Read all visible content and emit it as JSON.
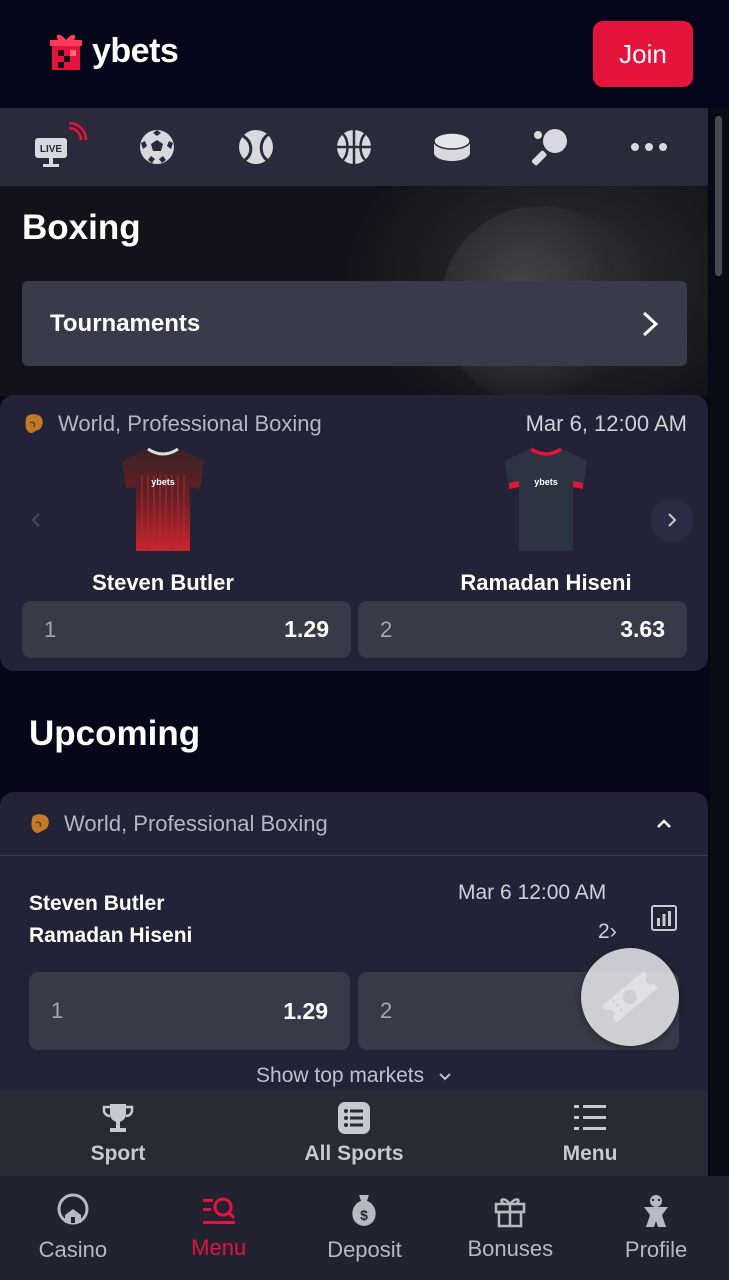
{
  "header": {
    "logo_text": "ybets",
    "join_label": "Join"
  },
  "sports_bar": {
    "items": [
      {
        "icon": "live-tv-icon",
        "badge": "LIVE"
      },
      {
        "icon": "soccer-ball-icon"
      },
      {
        "icon": "tennis-ball-icon"
      },
      {
        "icon": "basketball-icon"
      },
      {
        "icon": "ice-hockey-puck-icon"
      },
      {
        "icon": "table-tennis-icon"
      },
      {
        "icon": "more-icon"
      }
    ]
  },
  "hero": {
    "title": "Boxing",
    "tournaments_label": "Tournaments"
  },
  "featured_match": {
    "league": "World, Professional Boxing",
    "date": "Mar 6, 12:00 AM",
    "jersey_brand": "ybets",
    "team1": {
      "name": "Steven Butler",
      "jersey_color": "#b3232b"
    },
    "team2": {
      "name": "Ramadan Hiseni",
      "jersey_color": "#2c3442"
    },
    "odds": [
      {
        "label": "1",
        "value": "1.29"
      },
      {
        "label": "2",
        "value": "3.63"
      }
    ]
  },
  "upcoming": {
    "title": "Upcoming",
    "league": "World, Professional Boxing",
    "match": {
      "team1": "Steven Butler",
      "team2": "Ramadan Hiseni",
      "date": "Mar 6 12:00 AM",
      "more_markets": "2",
      "odds": [
        {
          "label": "1",
          "value": "1.29"
        },
        {
          "label": "2",
          "value": ""
        }
      ]
    },
    "show_top_markets": "Show top markets"
  },
  "sport_nav": {
    "items": [
      {
        "label": "Sport",
        "icon": "trophy-icon"
      },
      {
        "label": "All Sports",
        "icon": "list-icon"
      },
      {
        "label": "Menu",
        "icon": "menu-icon"
      }
    ]
  },
  "bottom_nav": {
    "items": [
      {
        "label": "Casino",
        "icon": "casino-icon",
        "active": false
      },
      {
        "label": "Menu",
        "icon": "search-menu-icon",
        "active": true
      },
      {
        "label": "Deposit",
        "icon": "deposit-icon",
        "active": false
      },
      {
        "label": "Bonuses",
        "icon": "gift-icon",
        "active": false
      },
      {
        "label": "Profile",
        "icon": "profile-icon",
        "active": false
      }
    ]
  },
  "colors": {
    "accent": "#e4143c",
    "background": "#07071a",
    "card": "#242236",
    "odds_button": "#3a3948"
  }
}
